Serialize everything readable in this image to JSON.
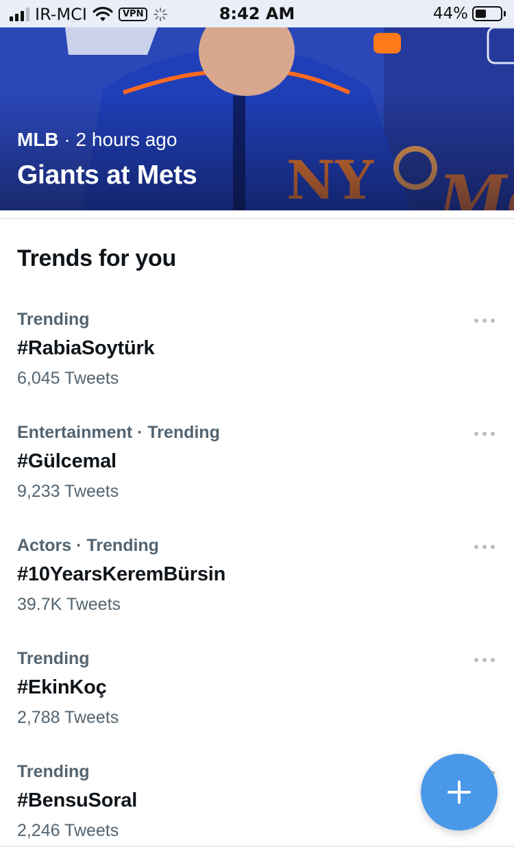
{
  "status_bar": {
    "carrier": "IR-MCI",
    "vpn_label": "VPN",
    "time": "8:42 AM",
    "battery_percent": "44%",
    "battery_level": 0.44,
    "signal_bars": 3,
    "signal_total": 4
  },
  "hero": {
    "source": "MLB",
    "separator": " · ",
    "time_ago": "2 hours ago",
    "title": "Giants at Mets"
  },
  "trends": {
    "heading": "Trends for you",
    "items": [
      {
        "context": "Trending",
        "tag": "#RabiaSoytürk",
        "count": "6,045 Tweets"
      },
      {
        "context": "Entertainment · Trending",
        "tag": "#Gülcemal",
        "count": "9,233 Tweets"
      },
      {
        "context": "Actors · Trending",
        "tag": "#10YearsKeremBürsin",
        "count": "39.7K Tweets"
      },
      {
        "context": "Trending",
        "tag": "#EkinKoç",
        "count": "2,788 Tweets"
      },
      {
        "context": "Trending",
        "tag": "#BensuSoral",
        "count": "2,246 Tweets"
      }
    ]
  },
  "fab": {
    "icon": "plus-icon"
  },
  "colors": {
    "accent": "#4a99e9",
    "secondary_text": "#536471",
    "primary_text": "#0f1419"
  }
}
